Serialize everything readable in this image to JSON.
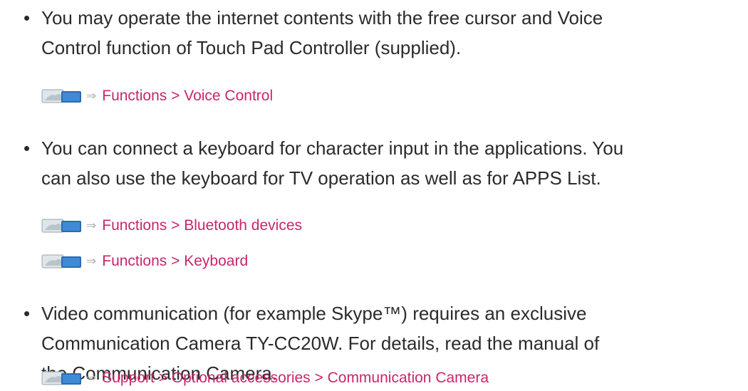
{
  "bullet_glyph": "•",
  "arrow_glyph": "⇒",
  "link_color": "#c8266b",
  "icons": {
    "manual": "ehelp-book-icon",
    "arrow": "arrow-right-icon"
  },
  "items": [
    {
      "lines": [
        "You may operate the internet contents with the free cursor and Voice",
        "Control function of Touch Pad Controller (supplied)."
      ],
      "refs": [
        "Functions > Voice Control"
      ]
    },
    {
      "lines": [
        "You can connect a keyboard for character input in the applications. You",
        "can also use the keyboard for TV operation as well as for APPS List."
      ],
      "refs": [
        "Functions > Bluetooth devices",
        "Functions > Keyboard"
      ]
    },
    {
      "lines": [
        "Video communication (for example Skype™) requires an exclusive",
        "Communication Camera TY-CC20W. For details, read the manual of",
        "the Communication Camera."
      ],
      "refs": [
        "Support > Optional accessories > Communication Camera"
      ]
    }
  ]
}
